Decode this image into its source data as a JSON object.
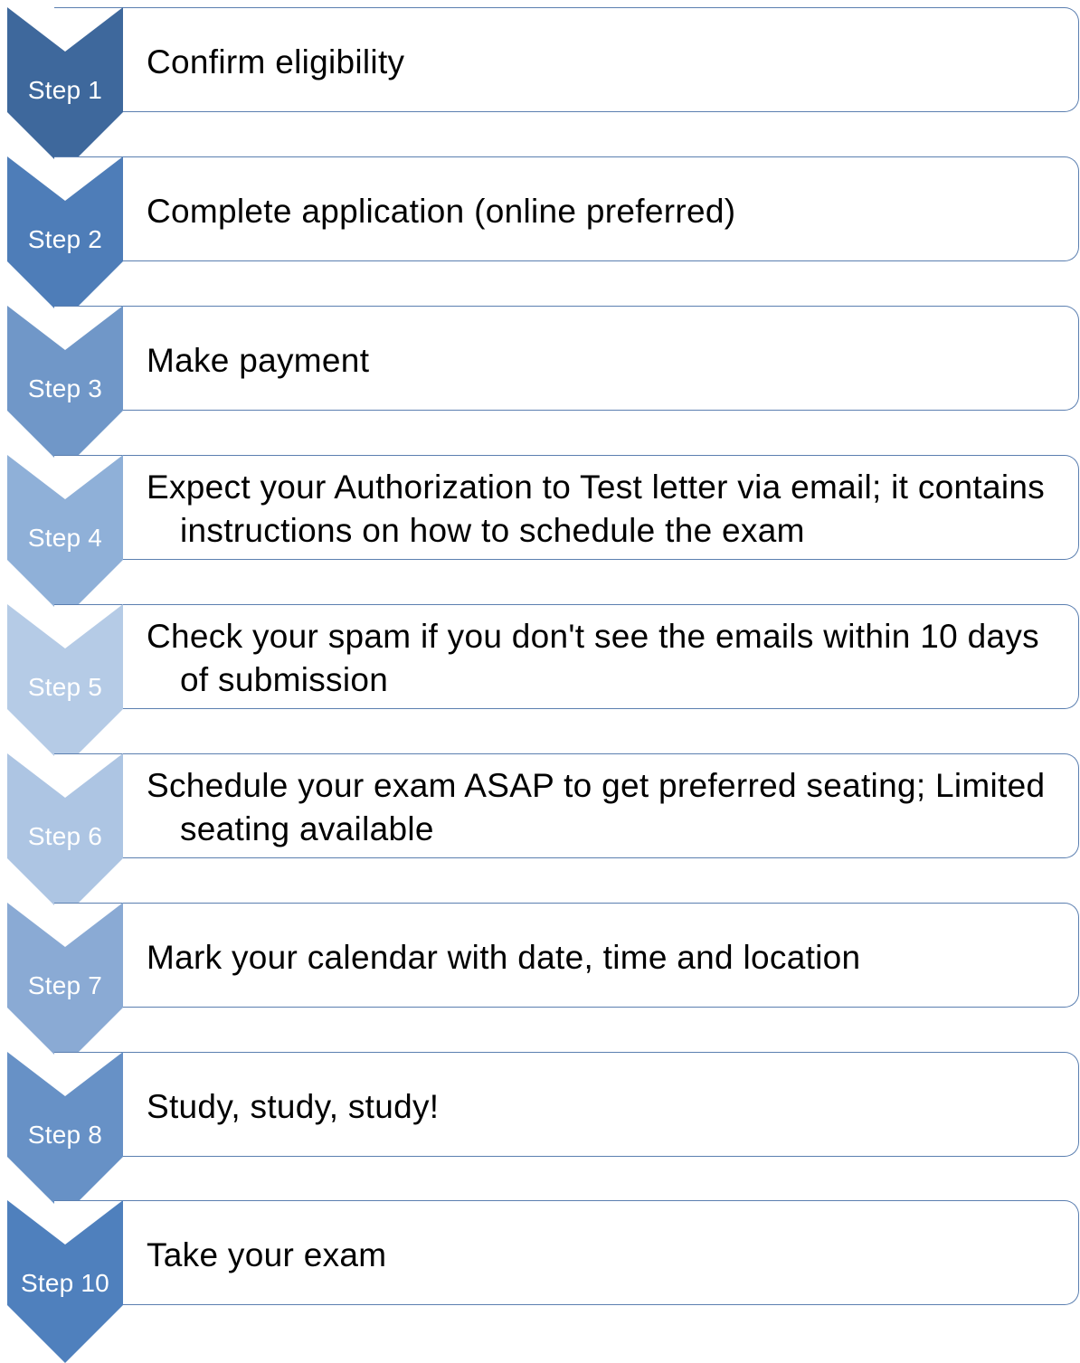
{
  "steps": [
    {
      "label": "Step 1",
      "text": "Confirm eligibility",
      "color": "#3e689c"
    },
    {
      "label": "Step 2",
      "text": "Complete application (online preferred)",
      "color": "#4e7db8"
    },
    {
      "label": "Step 3",
      "text": "Make payment",
      "color": "#7097c8"
    },
    {
      "label": "Step 4",
      "text": "Expect your Authorization to Test letter via email; it contains instructions on how to schedule the exam",
      "color": "#8fb0d8"
    },
    {
      "label": "Step 5",
      "text": "Check your spam if you don't see the emails within 10 days of submission",
      "color": "#b5cbe6"
    },
    {
      "label": "Step 6",
      "text": "Schedule your exam ASAP to get preferred seating; Limited seating available",
      "color": "#adc5e3"
    },
    {
      "label": "Step 7",
      "text": "Mark your calendar with date, time and location",
      "color": "#8aaad4"
    },
    {
      "label": "Step 8",
      "text": "Study, study, study!",
      "color": "#6791c6"
    },
    {
      "label": "Step 10",
      "text": "Take your exam",
      "color": "#4f80bd"
    }
  ]
}
